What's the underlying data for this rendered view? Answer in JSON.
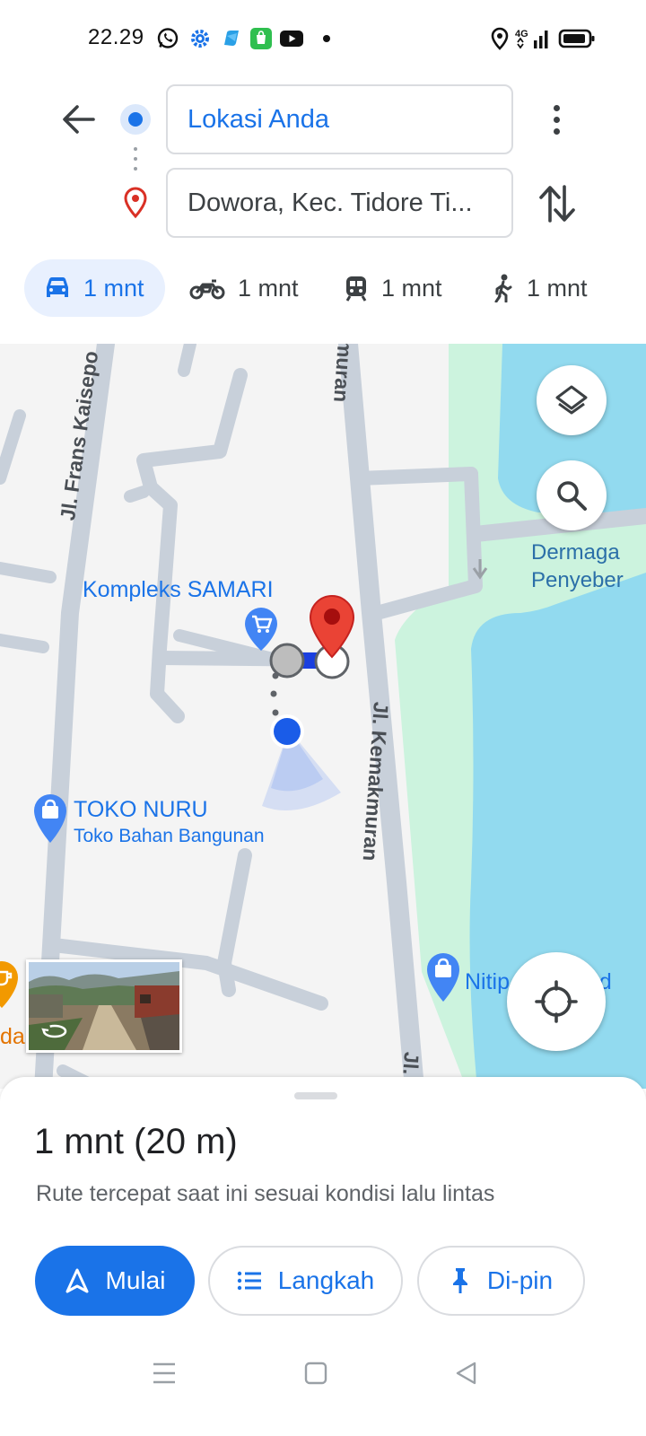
{
  "status_bar": {
    "time": "22.29",
    "network": "4G",
    "icons": [
      "whatsapp-icon",
      "settings-icon",
      "app-icon",
      "store-icon",
      "youtube-icon",
      "dot-icon",
      "location-icon",
      "signal-icon",
      "battery-icon"
    ]
  },
  "directions": {
    "origin": "Lokasi Anda",
    "destination": "Dowora, Kec. Tidore Ti..."
  },
  "travel_modes": [
    {
      "mode": "car",
      "label": "1 mnt",
      "selected": true
    },
    {
      "mode": "motorcycle",
      "label": "1 mnt",
      "selected": false
    },
    {
      "mode": "transit",
      "label": "1 mnt",
      "selected": false
    },
    {
      "mode": "walk",
      "label": "1 mnt",
      "selected": false
    }
  ],
  "map": {
    "roads": {
      "frans": "Jl. Frans Kaisepo",
      "kemakmuran_top": "muran",
      "kemakmuran": "Jl. Kemakmuran",
      "bottom": "Jl."
    },
    "pois": {
      "samari": "Kompleks SAMARI",
      "toko_nuru": "TOKO NURU",
      "toko_nuru_sub": "Toko Bahan Bangunan",
      "nitip": "Nitip",
      "nitip_suffix": "tud",
      "left_edge": "da"
    },
    "water": {
      "line1": "Dermaga",
      "line2": "Penyeber"
    },
    "colors": {
      "land": "#f4f4f4",
      "road": "#c8d0da",
      "water": "#92daef",
      "park": "#ccf3de",
      "route": "#1a73e8",
      "pin": "#ea4335"
    }
  },
  "sheet": {
    "summary": "1 mnt (20 m)",
    "subtitle": "Rute tercepat saat ini sesuai kondisi lalu lintas",
    "start_label": "Mulai",
    "steps_label": "Langkah",
    "pin_label": "Di-pin"
  }
}
